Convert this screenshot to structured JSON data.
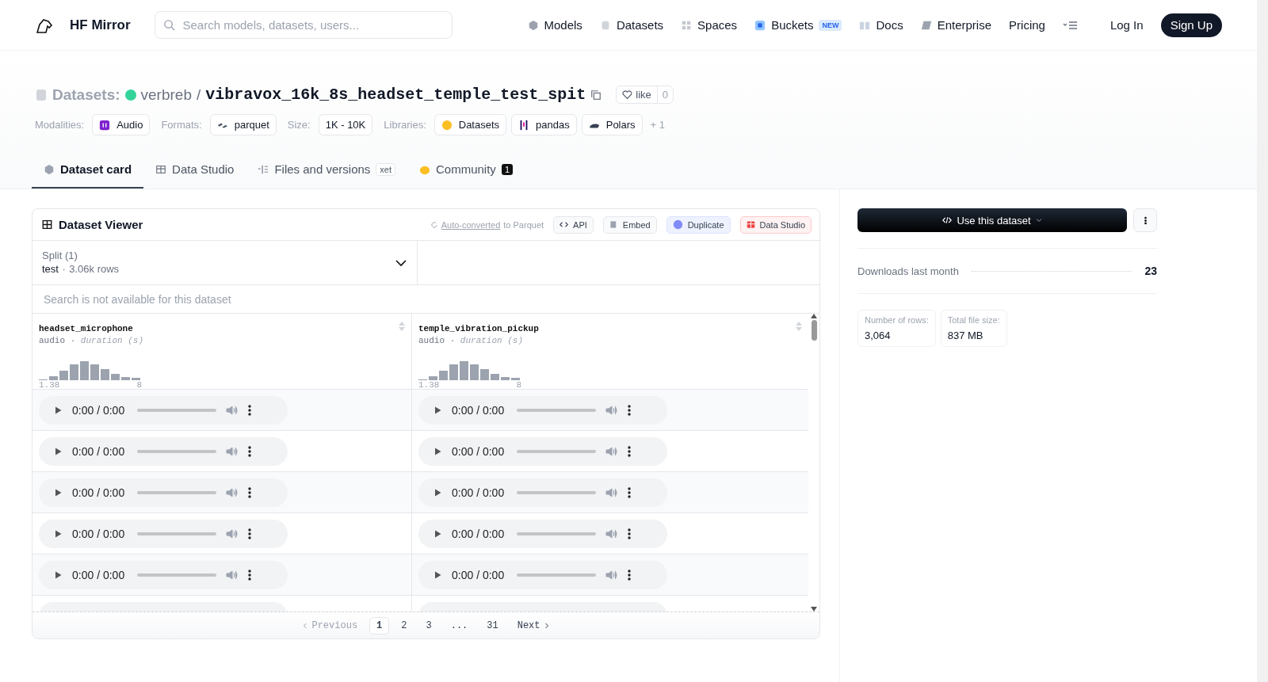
{
  "header": {
    "brand": "HF Mirror",
    "search_placeholder": "Search models, datasets, users...",
    "nav": [
      {
        "label": "Models"
      },
      {
        "label": "Datasets"
      },
      {
        "label": "Spaces"
      },
      {
        "label": "Buckets",
        "badge": "NEW"
      },
      {
        "label": "Docs"
      },
      {
        "label": "Enterprise"
      },
      {
        "label": "Pricing"
      }
    ],
    "login": "Log In",
    "signup": "Sign Up"
  },
  "title": {
    "prefix": "Datasets:",
    "owner": "verbreb",
    "separator": "/",
    "name": "vibravox_16k_8s_headset_temple_test_spit",
    "like": "like",
    "likes": "0"
  },
  "tags": [
    {
      "label": "Modalities:",
      "items": [
        "Audio"
      ]
    },
    {
      "label": "Formats:",
      "items": [
        "parquet"
      ]
    },
    {
      "label": "Size:",
      "items": [
        "1K - 10K"
      ]
    },
    {
      "label": "Libraries:",
      "items": [
        "Datasets",
        "pandas",
        "Polars"
      ]
    }
  ],
  "more_tags": "+ 1",
  "tabs": [
    {
      "label": "Dataset card",
      "selected": true
    },
    {
      "label": "Data Studio",
      "selected": false
    },
    {
      "label": "Files and versions",
      "badge": "xet",
      "selected": false
    },
    {
      "label": "Community",
      "count": "1",
      "selected": false
    }
  ],
  "viewer": {
    "title": "Dataset Viewer",
    "converted_link": "Auto-converted",
    "converted_rest": "to Parquet",
    "actions": [
      {
        "label": "API",
        "kind": "api"
      },
      {
        "label": "Embed",
        "kind": "embed"
      },
      {
        "label": "Duplicate",
        "kind": "duplicate"
      },
      {
        "label": "Data Studio",
        "kind": "studio"
      }
    ],
    "split_label": "Split (1)",
    "split_value": "test",
    "split_dot": "·",
    "split_rows": "3.06k rows",
    "search_placeholder": "Search is not available for this dataset",
    "columns": [
      {
        "name": "headset_microphone",
        "type": "audio",
        "dot": "·",
        "stat": "duration (s)",
        "min": "1.38",
        "max": "8"
      },
      {
        "name": "temple_vibration_pickup",
        "type": "audio",
        "dot": "·",
        "stat": "duration (s)",
        "min": "1.38",
        "max": "8"
      }
    ],
    "rows": [
      [
        "0:00 / 0:00",
        "0:00 / 0:00"
      ],
      [
        "0:00 / 0:00",
        "0:00 / 0:00"
      ],
      [
        "0:00 / 0:00",
        "0:00 / 0:00"
      ],
      [
        "0:00 / 0:00",
        "0:00 / 0:00"
      ],
      [
        "0:00 / 0:00",
        "0:00 / 0:00"
      ]
    ],
    "pagination": {
      "previous": "Previous",
      "next": "Next",
      "pages": [
        {
          "label": "1",
          "selected": true
        },
        {
          "label": "2",
          "selected": false
        },
        {
          "label": "3",
          "selected": false
        },
        {
          "label": "...",
          "selected": false
        },
        {
          "label": "31",
          "selected": false
        }
      ]
    }
  },
  "sidebar": {
    "use_button": "Use this dataset",
    "downloads_label": "Downloads last month",
    "downloads": "23",
    "stats": [
      {
        "label": "Number of rows:",
        "value": "3,064"
      },
      {
        "label": "Total file size:",
        "value": "837 MB"
      }
    ]
  }
}
